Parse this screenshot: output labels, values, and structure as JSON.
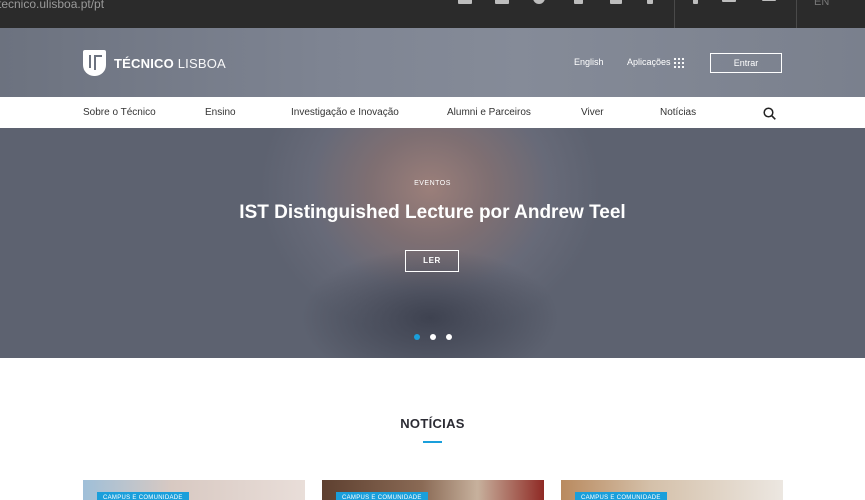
{
  "topbar": {
    "url_text": "tecnico.ulisboa.pt/pt",
    "lang": "EN",
    "icons": [
      "user-icon",
      "mail-icon",
      "globe-icon",
      "phone-icon",
      "people-icon",
      "mobile-icon",
      "facebook-icon",
      "twitter-icon",
      "menu-icon"
    ]
  },
  "header": {
    "brand_bold": "TÉCNICO",
    "brand_light": "LISBOA",
    "english_link": "English",
    "apps_link": "Aplicações",
    "login_button": "Entrar"
  },
  "nav": {
    "items": [
      "Sobre o Técnico",
      "Ensino",
      "Investigação e Inovação",
      "Alumni e Parceiros",
      "Viver",
      "Notícias"
    ]
  },
  "hero": {
    "tag": "EVENTOS",
    "title": "IST Distinguished Lecture por Andrew Teel",
    "button": "LER",
    "slides": 3,
    "active_slide": 1
  },
  "news": {
    "title": "NOTÍCIAS",
    "cards": [
      {
        "badge": "CAMPUS E COMUNIDADE"
      },
      {
        "badge": "CAMPUS E COMUNIDADE"
      },
      {
        "badge": "CAMPUS E COMUNIDADE"
      }
    ]
  },
  "colors": {
    "accent": "#1a9fdb",
    "topbar": "#2b2b2b",
    "header": "#7a808d"
  }
}
